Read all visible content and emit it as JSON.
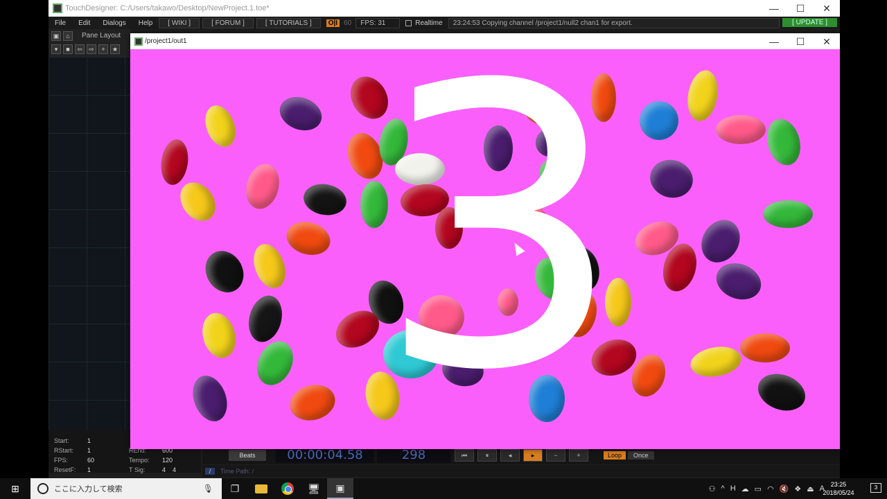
{
  "main_window": {
    "title": "TouchDesigner: C:/Users/takawo/Desktop/NewProject.1.toe*",
    "controls": {
      "minimize": "—",
      "maximize": "☐",
      "close": "✕"
    }
  },
  "menubar": {
    "items": [
      "File",
      "Edit",
      "Dialogs",
      "Help"
    ],
    "wiki": "[ WIKI ]",
    "forum": "[ FORUM ]",
    "tutorials": "[ TUTORIALS ]",
    "oi": "O|I",
    "fps_limit": "60",
    "fps": "FPS:  31",
    "realtime": "Realtime",
    "status": "23:24:53 Copying channel /project1/null2 chan1 for export.",
    "update": "[ UPDATE ]"
  },
  "toolbar": {
    "pane_layout": "Pane Layout"
  },
  "viewer": {
    "title": "/project1/out1",
    "countdown": "3",
    "background": "#fb5ffb",
    "controls": {
      "minimize": "—",
      "maximize": "☐",
      "close": "✕"
    }
  },
  "timeline": {
    "start_label": "Start:",
    "start": "1",
    "rstart_label": "RStart:",
    "rstart": "1",
    "rend_label": "REnd:",
    "rend": "600",
    "fps_label": "FPS:",
    "fps": "60",
    "tempo_label": "Tempo:",
    "tempo": "120",
    "resetf_label": "ResetF:",
    "resetf": "1",
    "tsig_label": "T Sig:",
    "tsig_a": "4",
    "tsig_b": "4",
    "beats": "Beats",
    "timecode": "00:00:04.58",
    "frame": "298",
    "loop": "Loop",
    "once": "Once",
    "time_path": "Time Path: /"
  },
  "taskbar": {
    "search_placeholder": "ここに入力して検索",
    "time": "23:25",
    "date": "2018/05/24",
    "notifications": "3"
  }
}
